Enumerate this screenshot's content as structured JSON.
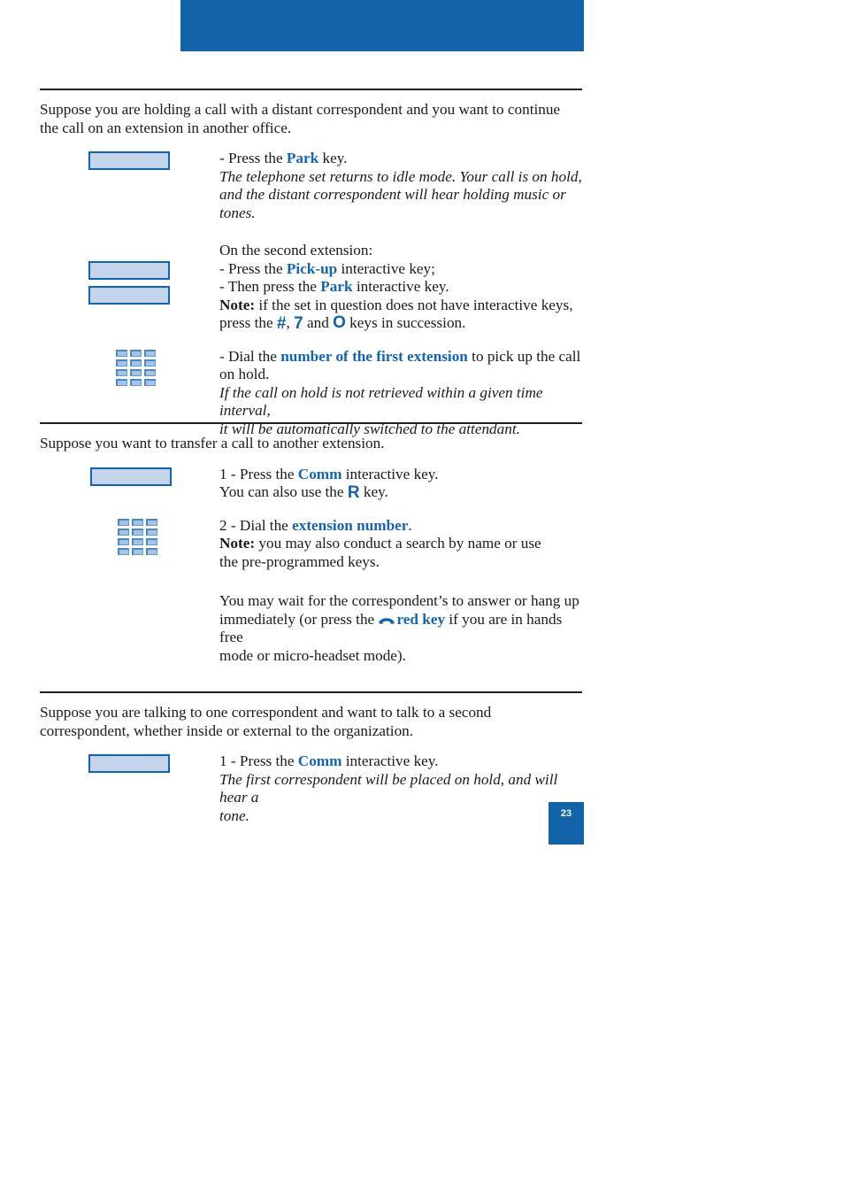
{
  "document": {
    "page_number": "23",
    "banner_color": "#1263a8",
    "accent_color": "#1565ad",
    "softkey_fill": "#c4d4ec",
    "softkey_border": "#1263a8"
  },
  "sections": [
    {
      "id": "parking-a-call",
      "intro": "Suppose you are holding a call with a distant correspondent and you want to continue the call on an extension in another office.",
      "steps": [
        {
          "icon": "softkey",
          "lines": [
            {
              "segments": [
                {
                  "t": "- Press the ",
                  "s": "plain"
                },
                {
                  "t": "Park",
                  "s": "blue"
                },
                {
                  "t": " key.",
                  "s": "plain"
                }
              ]
            },
            {
              "segments": [
                {
                  "t": "The telephone set returns to idle mode. Your call is on hold,",
                  "s": "italic"
                }
              ]
            },
            {
              "segments": [
                {
                  "t": "and the distant correspondent will hear holding music or tones.",
                  "s": "italic"
                }
              ]
            }
          ]
        },
        {
          "icon": "softkey-double",
          "lines": [
            {
              "segments": [
                {
                  "t": "On the second extension:",
                  "s": "plain"
                }
              ]
            },
            {
              "segments": [
                {
                  "t": "- Press the ",
                  "s": "plain"
                },
                {
                  "t": "Pick-up",
                  "s": "blue"
                },
                {
                  "t": " interactive key;",
                  "s": "plain"
                }
              ]
            },
            {
              "segments": [
                {
                  "t": "- Then press the ",
                  "s": "plain"
                },
                {
                  "t": "Park",
                  "s": "blue"
                },
                {
                  "t": " interactive key.",
                  "s": "plain"
                }
              ]
            },
            {
              "segments": [
                {
                  "t": "Note:",
                  "s": "bold"
                },
                {
                  "t": " if the set in question does not have interactive keys,",
                  "s": "plain"
                }
              ]
            },
            {
              "segments": [
                {
                  "t": "press the ",
                  "s": "plain"
                },
                {
                  "t": "#",
                  "s": "glyph"
                },
                {
                  "t": ", ",
                  "s": "plain"
                },
                {
                  "t": "7",
                  "s": "glyph"
                },
                {
                  "t": " and ",
                  "s": "plain"
                },
                {
                  "t": "O",
                  "s": "glyph"
                },
                {
                  "t": " keys in succession.",
                  "s": "plain"
                }
              ]
            }
          ]
        },
        {
          "icon": "keypad",
          "lines": [
            {
              "segments": [
                {
                  "t": "- Dial the ",
                  "s": "plain"
                },
                {
                  "t": "number of the first extension",
                  "s": "blue"
                },
                {
                  "t": " to pick up the call",
                  "s": "plain"
                }
              ]
            },
            {
              "segments": [
                {
                  "t": "on hold.",
                  "s": "plain"
                }
              ]
            },
            {
              "segments": [
                {
                  "t": "If the call on hold is not retrieved within a given time interval,",
                  "s": "italic"
                }
              ]
            },
            {
              "segments": [
                {
                  "t": "it will be automatically switched to the attendant.",
                  "s": "italic"
                }
              ]
            }
          ]
        }
      ]
    },
    {
      "id": "transferring-a-call",
      "intro": "Suppose you want to transfer a call to another extension.",
      "steps": [
        {
          "icon": "softkey",
          "lines": [
            {
              "segments": [
                {
                  "t": "1 - Press the ",
                  "s": "plain"
                },
                {
                  "t": "Comm",
                  "s": "blue"
                },
                {
                  "t": " interactive key.",
                  "s": "plain"
                }
              ]
            },
            {
              "segments": [
                {
                  "t": "You can also use the ",
                  "s": "plain"
                },
                {
                  "t": "R",
                  "s": "glyph"
                },
                {
                  "t": " key.",
                  "s": "plain"
                }
              ]
            }
          ]
        },
        {
          "icon": "keypad",
          "lines": [
            {
              "segments": [
                {
                  "t": "2 - Dial the ",
                  "s": "plain"
                },
                {
                  "t": "extension number",
                  "s": "blue"
                },
                {
                  "t": ".",
                  "s": "plain"
                }
              ]
            },
            {
              "segments": [
                {
                  "t": "Note:",
                  "s": "bold"
                },
                {
                  "t": " you may also conduct a search by name or use",
                  "s": "plain"
                }
              ]
            },
            {
              "segments": [
                {
                  "t": "the pre-programmed keys.",
                  "s": "plain"
                }
              ]
            }
          ]
        },
        {
          "icon": "none",
          "lines": [
            {
              "segments": [
                {
                  "t": "You may wait for the correspondent’s to answer or hang up",
                  "s": "plain"
                }
              ]
            },
            {
              "segments": [
                {
                  "t": "immediately (or press the ",
                  "s": "plain"
                },
                {
                  "t": "handset-icon",
                  "s": "handset"
                },
                {
                  "t": "red key",
                  "s": "blue"
                },
                {
                  "t": " if you are in hands free",
                  "s": "plain"
                }
              ]
            },
            {
              "segments": [
                {
                  "t": "mode or micro-headset mode).",
                  "s": "plain"
                }
              ]
            }
          ]
        }
      ]
    },
    {
      "id": "second-call-during-conversation",
      "intro": "Suppose you are talking to one correspondent and want to talk to a second correspondent, whether inside or external to the organization.",
      "steps": [
        {
          "icon": "softkey",
          "lines": [
            {
              "segments": [
                {
                  "t": "1 - Press the ",
                  "s": "plain"
                },
                {
                  "t": "Comm",
                  "s": "blue"
                },
                {
                  "t": " interactive key.",
                  "s": "plain"
                }
              ]
            },
            {
              "segments": [
                {
                  "t": "The first correspondent will be placed on hold, and will hear a",
                  "s": "italic"
                }
              ]
            },
            {
              "segments": [
                {
                  "t": "tone.",
                  "s": "italic"
                }
              ]
            }
          ]
        }
      ]
    }
  ]
}
